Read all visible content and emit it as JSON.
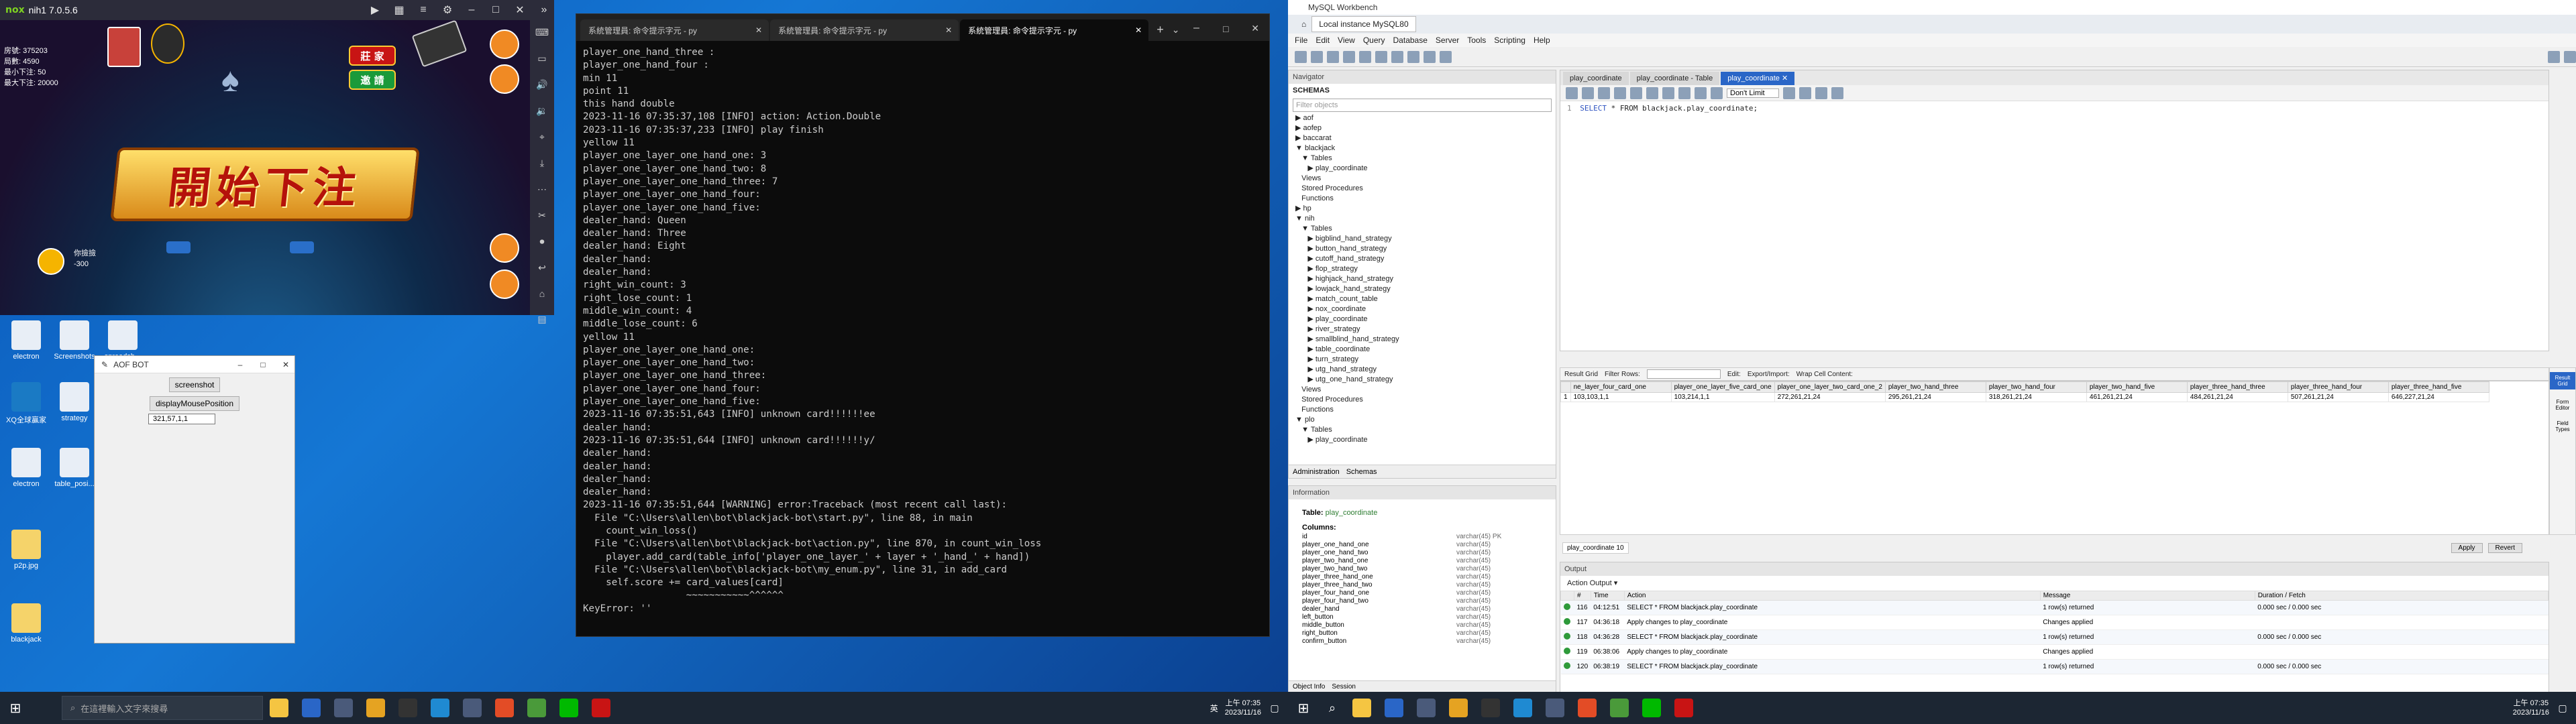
{
  "nox": {
    "logo": "nox",
    "title": "nih1 7.0.5.6",
    "game": {
      "info_lines": [
        "房號: 375203",
        "局數: 4590",
        "最小下注: 50",
        "最大下注: 20000"
      ],
      "banner": "開始下注",
      "btn_banker": "莊 家",
      "btn_invite": "邀 請",
      "player_name": "你撿撿",
      "player_balance": "-300"
    }
  },
  "desktop": {
    "icons": [
      {
        "label": "electron"
      },
      {
        "label": "Screenshots"
      },
      {
        "label": "spreadsh..."
      },
      {
        "label": "XQ全球贏家"
      },
      {
        "label": "strategy"
      },
      {
        "label": "electron"
      },
      {
        "label": "table_posi..."
      },
      {
        "label": "p2p.jpg"
      },
      {
        "label": "blackjack"
      }
    ]
  },
  "aof": {
    "title": "AOF BOT",
    "screenshot_btn": "screenshot",
    "display_btn": "displayMousePosition",
    "coords": "321,57,1,1"
  },
  "terminal": {
    "tabs": [
      "系統管理員: 命令提示字元 - py",
      "系統管理員: 命令提示字元 - py",
      "系統管理員: 命令提示字元 - py"
    ],
    "lines": [
      "player_one_hand_three :",
      "player_one_hand_four :",
      "min 11",
      "point 11",
      "this hand double",
      "2023-11-16 07:35:37,108 [INFO] action: Action.Double",
      "2023-11-16 07:35:37,233 [INFO] play finish",
      "yellow 11",
      "player_one_layer_one_hand_one: 3",
      "player_one_layer_one_hand_two: 8",
      "player_one_layer_one_hand_three: 7",
      "player_one_layer_one_hand_four:",
      "player_one_layer_one_hand_five:",
      "dealer_hand: Queen",
      "dealer_hand: Three",
      "dealer_hand: Eight",
      "dealer_hand:",
      "dealer_hand:",
      "right_win_count: 3",
      "right_lose_count: 1",
      "middle_win_count: 4",
      "middle_lose_count: 6",
      "yellow 11",
      "player_one_layer_one_hand_one:",
      "player_one_layer_one_hand_two:",
      "player_one_layer_one_hand_three:",
      "player_one_layer_one_hand_four:",
      "player_one_layer_one_hand_five:",
      "2023-11-16 07:35:51,643 [INFO] unknown card!!!!!!ee",
      "dealer_hand:",
      "2023-11-16 07:35:51,644 [INFO] unknown card!!!!!!y/",
      "dealer_hand:",
      "dealer_hand:",
      "dealer_hand:",
      "dealer_hand:",
      "2023-11-16 07:35:51,644 [WARNING] error:Traceback (most recent call last):",
      "  File \"C:\\Users\\allen\\bot\\blackjack-bot\\start.py\", line 88, in main",
      "    count_win_loss()",
      "  File \"C:\\Users\\allen\\bot\\blackjack-bot\\action.py\", line 870, in count_win_loss",
      "    player.add_card(table_info['player_one_layer_' + layer + '_hand_' + hand])",
      "  File \"C:\\Users\\allen\\bot\\blackjack-bot\\my_enum.py\", line 31, in add_card",
      "    self.score += card_values[card]",
      "                  ~~~~~~~~~~~^^^^^^",
      "KeyError: ''"
    ]
  },
  "taskbar1": {
    "search_placeholder": "在這裡輸入文字來搜尋",
    "ime": "英",
    "time": "上午 07:35",
    "date": "2023/11/16"
  },
  "workbench": {
    "title": "MySQL Workbench",
    "instance_tab": "Local instance MySQL80",
    "menu": [
      "File",
      "Edit",
      "View",
      "Query",
      "Database",
      "Server",
      "Tools",
      "Scripting",
      "Help"
    ],
    "navigator_label": "Navigator",
    "schemas_label": "SCHEMAS",
    "filter_placeholder": "Filter objects",
    "tree": [
      "▶ aof",
      "▶ aofep",
      "▶ baccarat",
      "▼ blackjack",
      "   ▼ Tables",
      "      ▶ play_coordinate",
      "   Views",
      "   Stored Procedures",
      "   Functions",
      "▶ hp",
      "▼ nih",
      "   ▼ Tables",
      "      ▶ bigblind_hand_strategy",
      "      ▶ button_hand_strategy",
      "      ▶ cutoff_hand_strategy",
      "      ▶ flop_strategy",
      "      ▶ highjack_hand_strategy",
      "      ▶ lowjack_hand_strategy",
      "      ▶ match_count_table",
      "      ▶ nox_coordinate",
      "      ▶ play_coordinate",
      "      ▶ river_strategy",
      "      ▶ smallblind_hand_strategy",
      "      ▶ table_coordinate",
      "      ▶ turn_strategy",
      "      ▶ utg_hand_strategy",
      "      ▶ utg_one_hand_strategy",
      "   Views",
      "   Stored Procedures",
      "   Functions",
      "▼ plo",
      "   ▼ Tables",
      "      ▶ play_coordinate"
    ],
    "nav_tabs": [
      "Administration",
      "Schemas"
    ],
    "info_label": "Information",
    "info_table_label": "Table:",
    "info_table_name": "play_coordinate",
    "columns_label": "Columns:",
    "columns": [
      {
        "name": "id",
        "type": "varchar(45) PK"
      },
      {
        "name": "player_one_hand_one",
        "type": "varchar(45)"
      },
      {
        "name": "player_one_hand_two",
        "type": "varchar(45)"
      },
      {
        "name": "player_two_hand_one",
        "type": "varchar(45)"
      },
      {
        "name": "player_two_hand_two",
        "type": "varchar(45)"
      },
      {
        "name": "player_three_hand_one",
        "type": "varchar(45)"
      },
      {
        "name": "player_three_hand_two",
        "type": "varchar(45)"
      },
      {
        "name": "player_four_hand_one",
        "type": "varchar(45)"
      },
      {
        "name": "player_four_hand_two",
        "type": "varchar(45)"
      },
      {
        "name": "dealer_hand",
        "type": "varchar(45)"
      },
      {
        "name": "left_button",
        "type": "varchar(45)"
      },
      {
        "name": "middle_button",
        "type": "varchar(45)"
      },
      {
        "name": "right_button",
        "type": "varchar(45)"
      },
      {
        "name": "confirm_button",
        "type": "varchar(45)"
      }
    ],
    "info_tabs": [
      "Object Info",
      "Session"
    ],
    "editor_tabs": [
      "play_coordinate",
      "play_coordinate - Table",
      "play_coordinate"
    ],
    "limit_select": "Don't Limit",
    "sql_line_no": "1",
    "sql_kw1": "SELECT",
    "sql_rest": " * FROM blackjack.play_coordinate;",
    "grid_bar": [
      "Result Grid",
      "Filter Rows:",
      "Edit:",
      "Export/Import:",
      "Wrap Cell Content:"
    ],
    "grid_headers": [
      "ne_layer_four_card_one",
      "player_one_layer_five_card_one",
      "player_one_layer_two_card_one_2",
      "player_two_hand_three",
      "player_two_hand_four",
      "player_two_hand_five",
      "player_three_hand_three",
      "player_three_hand_four",
      "player_three_hand_five"
    ],
    "grid_row": [
      "1",
      "103,103,1,1",
      "103,214,1,1",
      "272,261,21,24",
      "295,261,21,24",
      "318,261,21,24",
      "461,261,21,24",
      "484,261,21,24",
      "507,261,21,24",
      "646,227,21,24"
    ],
    "right_panel": [
      "Result Grid",
      "Form Editor",
      "Field Types"
    ],
    "apply_label": "Apply",
    "revert_label": "Revert",
    "result_tab": "play_coordinate 10",
    "output_label": "Output",
    "output_select": "Action Output",
    "output_headers": [
      "#",
      "Time",
      "Action",
      "Message",
      "Duration / Fetch"
    ],
    "output_rows": [
      {
        "n": "116",
        "time": "04:12:51",
        "action": "SELECT * FROM blackjack.play_coordinate",
        "msg": "1 row(s) returned",
        "dur": "0.000 sec / 0.000 sec"
      },
      {
        "n": "117",
        "time": "04:36:18",
        "action": "Apply changes to play_coordinate",
        "msg": "Changes applied",
        "dur": ""
      },
      {
        "n": "118",
        "time": "04:36:28",
        "action": "SELECT * FROM blackjack.play_coordinate",
        "msg": "1 row(s) returned",
        "dur": "0.000 sec / 0.000 sec"
      },
      {
        "n": "119",
        "time": "06:38:06",
        "action": "Apply changes to play_coordinate",
        "msg": "Changes applied",
        "dur": ""
      },
      {
        "n": "120",
        "time": "06:38:19",
        "action": "SELECT * FROM blackjack.play_coordinate",
        "msg": "1 row(s) returned",
        "dur": "0.000 sec / 0.000 sec"
      }
    ]
  },
  "taskbar2": {
    "time": "上午 07:35",
    "date": "2023/11/16"
  }
}
